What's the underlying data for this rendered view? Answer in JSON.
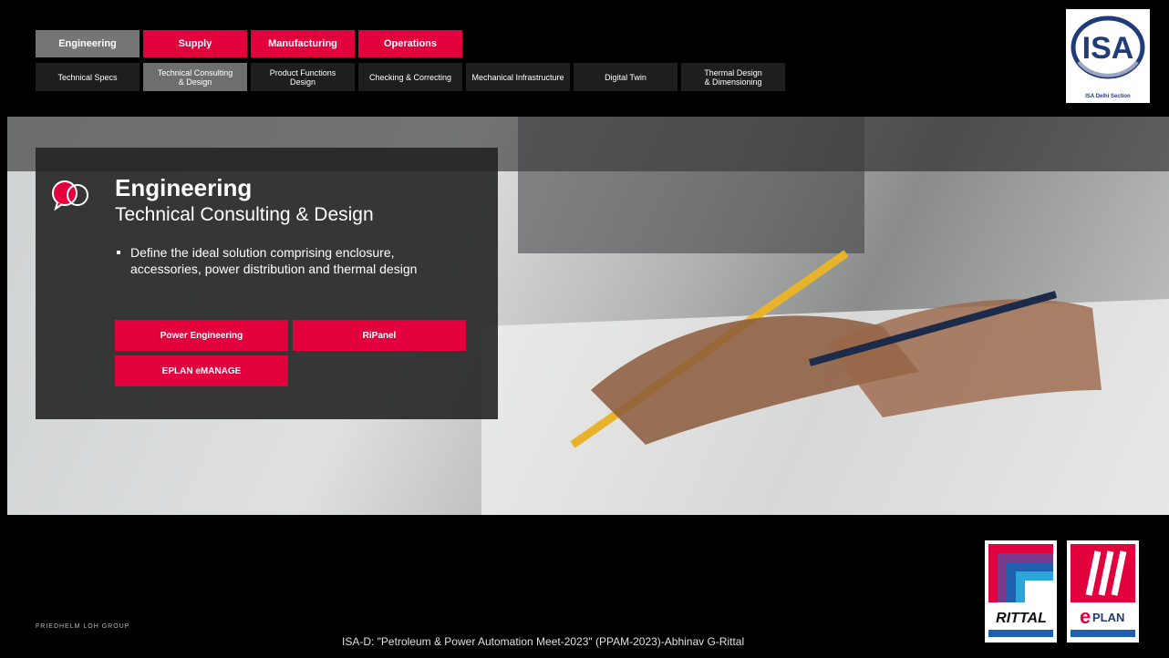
{
  "nav": {
    "tabs": [
      "Engineering",
      "Supply",
      "Manufacturing",
      "Operations"
    ],
    "subtabs": [
      "Technical Specs",
      "Technical Consulting\n& Design",
      "Product Functions\nDesign",
      "Checking & Correcting",
      "Mechanical Infrastructure",
      "Digital Twin",
      "Thermal Design\n& Dimensioning"
    ]
  },
  "isa_logo": {
    "text": "ISA",
    "caption": "ISA Delhi Section"
  },
  "panel": {
    "title": "Engineering",
    "subtitle": "Technical Consulting & Design",
    "bullet": "Define the ideal solution comprising enclosure, accessories, power distribution and thermal design",
    "buttons": [
      "Power Engineering",
      "RiPanel",
      "EPLAN eMANAGE"
    ]
  },
  "footer": {
    "left": "FRIEDHELM LOH GROUP",
    "center": "ISA-D: \"Petroleum & Power Automation Meet-2023\" (PPAM-2023)-Abhinav G-Rittal"
  },
  "logos": {
    "rittal": "RITTAL",
    "eplan": "PLAN",
    "eplan_e": "e"
  },
  "colors": {
    "accent": "#e2003d",
    "active_tab": "#767676",
    "panel": "#232323"
  }
}
